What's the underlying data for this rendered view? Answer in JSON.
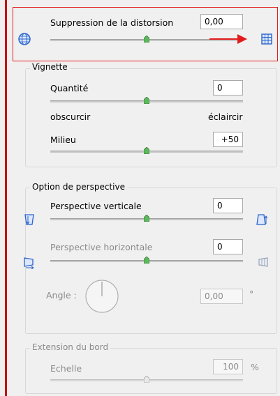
{
  "distortion": {
    "label": "Suppression de la distorsion",
    "value": "0,00",
    "slider_fraction": 0.5,
    "left_icon": "globe-icon",
    "right_icon": "grid-icon"
  },
  "vignette": {
    "title": "Vignette",
    "quantite_label": "Quantité",
    "quantite_value": "0",
    "quantite_fraction": 0.5,
    "left_hint": "obscurcir",
    "right_hint": "éclaircir",
    "milieu_label": "Milieu",
    "milieu_value": "+50",
    "milieu_fraction": 0.5
  },
  "perspective": {
    "title": "Option de perspective",
    "vertical_label": "Perspective verticale",
    "vertical_value": "0",
    "vertical_fraction": 0.5,
    "horizontal_label": "Perspective horizontale",
    "horizontal_value": "0",
    "horizontal_fraction": 0.5,
    "angle_label": "Angle :",
    "angle_value": "0,00",
    "angle_unit": "°"
  },
  "extension": {
    "title": "Extension du bord",
    "echelle_label": "Echelle",
    "echelle_value": "100",
    "echelle_unit": "%",
    "echelle_fraction": 0.5
  },
  "colors": {
    "highlight": "#e21b1b",
    "thumb_green": "#5cb85c"
  }
}
